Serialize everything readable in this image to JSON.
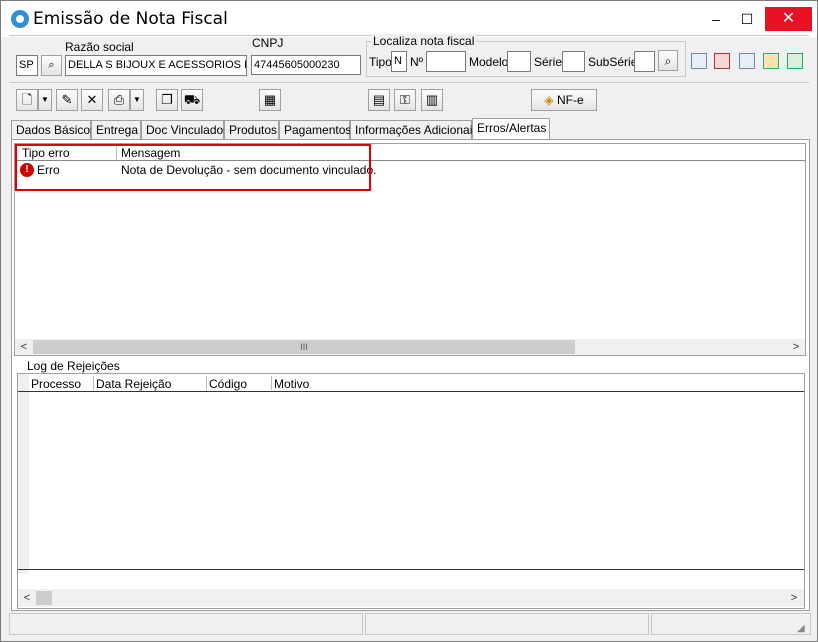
{
  "window": {
    "title": "Emissão de Nota Fiscal"
  },
  "titlebar": {
    "minimize": "–",
    "maximize": "☐",
    "close": "✕"
  },
  "header": {
    "uf_value": "SP",
    "razao_social_label": "Razão social",
    "razao_social_value": "DELLA S BIJOUX E ACESSORIOS LTD",
    "cnpj_label": "CNPJ",
    "cnpj_value": "47445605000230"
  },
  "localiza": {
    "group_label": "Localiza nota fiscal",
    "tipo_label": "Tipo",
    "tipo_value": "N",
    "numero_label": "Nº",
    "numero_value": "",
    "modelo_label": "Modelo",
    "modelo_value": "",
    "serie_label": "Série",
    "serie_value": "",
    "subserie_label": "SubSérie",
    "subserie_value": ""
  },
  "toolbar": {
    "nfe_label": "NF-e"
  },
  "tabs": [
    {
      "label": "Dados Básicos"
    },
    {
      "label": "Entrega"
    },
    {
      "label": "Doc Vinculados"
    },
    {
      "label": "Produtos"
    },
    {
      "label": "Pagamentos"
    },
    {
      "label": "Informações Adicionais"
    },
    {
      "label": "Erros/Alertas"
    }
  ],
  "errors": {
    "columns": [
      "Tipo erro",
      "Mensagem"
    ],
    "rows": [
      {
        "tipo": "Erro",
        "mensagem": "Nota de Devolução - sem documento vinculado."
      }
    ],
    "scroll_grip": "III",
    "highlight_color": "#e00000"
  },
  "log": {
    "group_label": "Log de Rejeições",
    "columns": [
      "Processo",
      "Data Rejeição",
      "Código",
      "Motivo"
    ]
  },
  "colors": {
    "close_red": "#e81123",
    "panel_bg": "#ffffff",
    "chrome_bg": "#f0f0f0"
  }
}
